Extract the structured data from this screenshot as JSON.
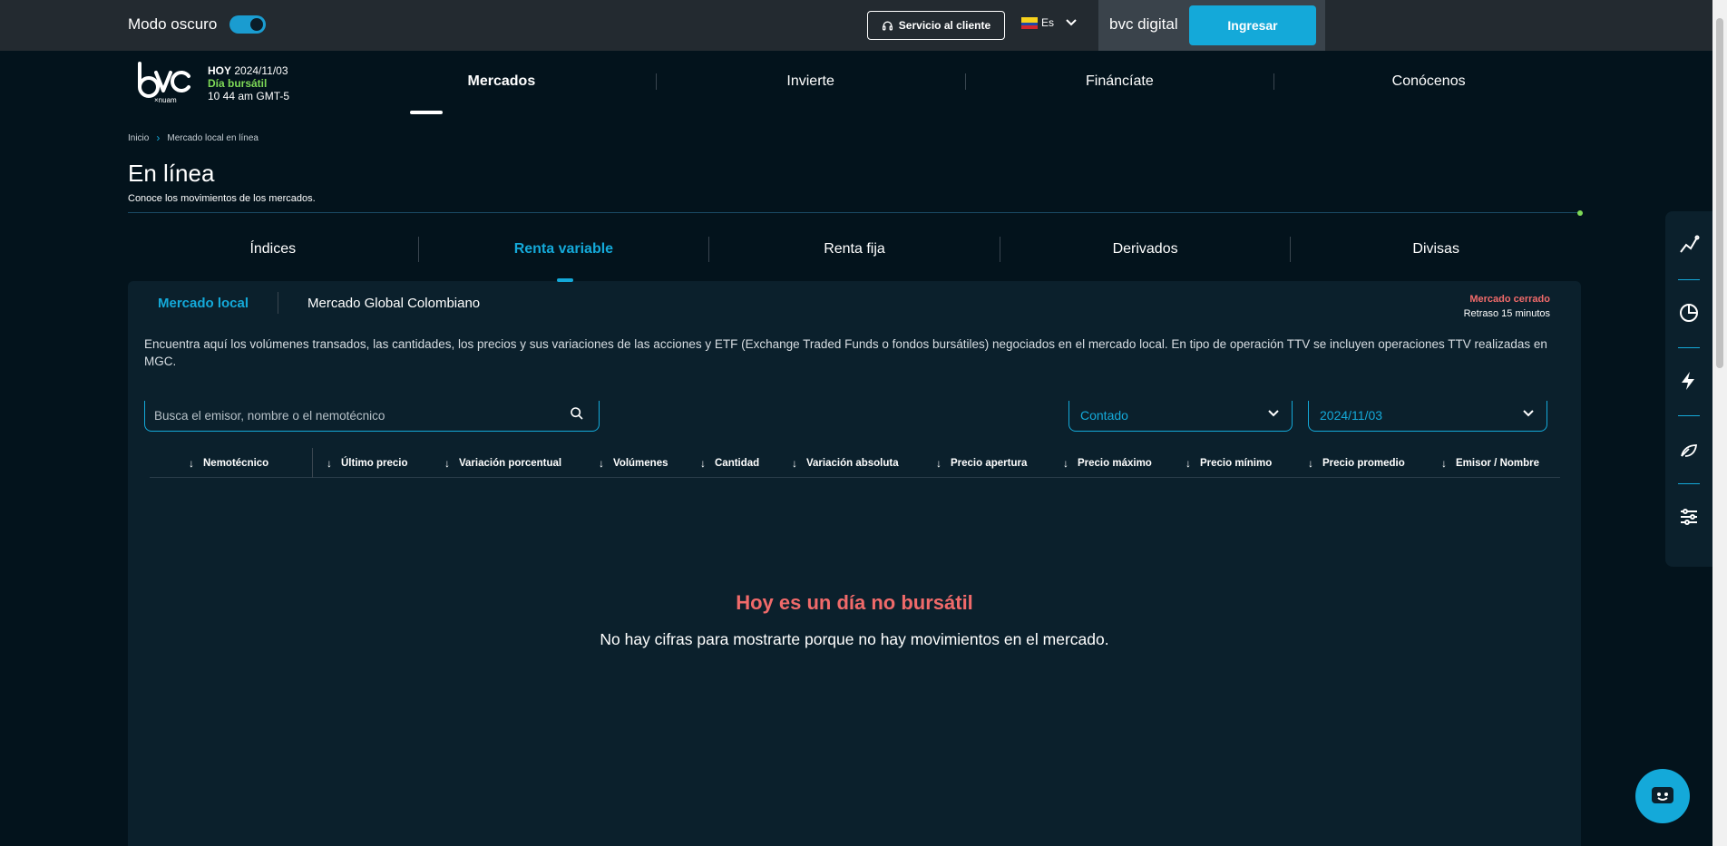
{
  "topbar": {
    "dark_mode_label": "Modo oscuro",
    "service_label": "Servicio al cliente",
    "lang_label": "Es",
    "digital_label": "bvc digital",
    "login_label": "Ingresar"
  },
  "header": {
    "logo_text": "bvc",
    "logo_sub": "×nuam",
    "today_label": "HOY",
    "today_date": "2024/11/03",
    "day_type": "Día bursátil",
    "time": "10 44 am GMT-5",
    "nav": [
      "Mercados",
      "Invierte",
      "Fináncíate",
      "Conócenos"
    ]
  },
  "breadcrumb": [
    "Inicio",
    "Mercado local en línea"
  ],
  "page": {
    "title": "En línea",
    "subtitle": "Conoce los movimientos de los mercados."
  },
  "tabs": [
    "Índices",
    "Renta variable",
    "Renta fija",
    "Derivados",
    "Divisas"
  ],
  "subtabs": [
    "Mercado local",
    "Mercado Global Colombiano"
  ],
  "market_status": {
    "state": "Mercado cerrado",
    "delay": "Retraso 15 minutos"
  },
  "description": "Encuentra aquí los volúmenes transados, las cantidades, los precios y sus variaciones de las acciones y ETF (Exchange Traded Funds o fondos bursátiles) negociados en el mercado local. En tipo de operación TTV se incluyen operaciones TTV realizadas en MGC.",
  "filters": {
    "search_placeholder": "Busca el emisor, nombre o el nemotécnico",
    "operation": "Contado",
    "date": "2024/11/03"
  },
  "columns": [
    "Nemotécnico",
    "Último precio",
    "Variación porcentual",
    "Volúmenes",
    "Cantidad",
    "Variación absoluta",
    "Precio apertura",
    "Precio máximo",
    "Precio mínimo",
    "Precio promedio",
    "Emisor / Nombre"
  ],
  "empty_state": {
    "title": "Hoy es un día no bursátil",
    "text": "No hay cifras para mostrarte porque no hay movimientos en el mercado."
  },
  "colors": {
    "accent": "#14a9d9",
    "background": "#03131c",
    "panel": "#0b202c",
    "alert": "#f06a6a",
    "positive": "#7ed957"
  },
  "icons": [
    "headset-icon",
    "chevron-down-icon",
    "search-icon",
    "line-chart-icon",
    "pie-chart-icon",
    "lightning-icon",
    "leaf-icon",
    "sliders-icon",
    "chat-bot-icon"
  ]
}
